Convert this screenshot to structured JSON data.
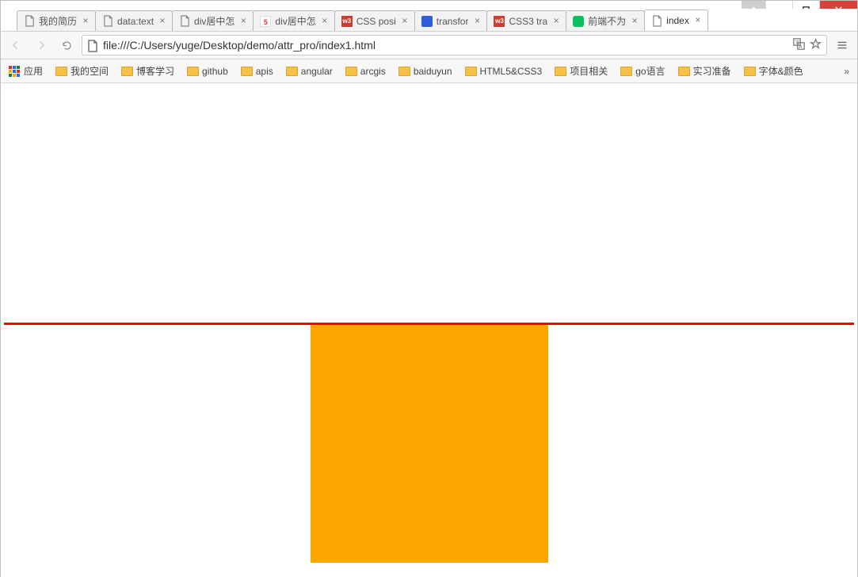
{
  "window": {
    "tabs": [
      {
        "title": "我的简历",
        "icon": "page"
      },
      {
        "title": "data:text",
        "icon": "page"
      },
      {
        "title": "div居中怎",
        "icon": "page"
      },
      {
        "title": "div居中怎",
        "icon": "s5"
      },
      {
        "title": "CSS posi",
        "icon": "w3"
      },
      {
        "title": "transfor",
        "icon": "baidu"
      },
      {
        "title": "CSS3 tra",
        "icon": "w3"
      },
      {
        "title": "前端不为",
        "icon": "wechat"
      },
      {
        "title": "index",
        "icon": "page",
        "active": true
      }
    ]
  },
  "toolbar": {
    "url": "file:///C:/Users/yuge/Desktop/demo/attr_pro/index1.html"
  },
  "bookmarks": {
    "apps_label": "应用",
    "items": [
      "我的空间",
      "博客学习",
      "github",
      "apis",
      "angular",
      "arcgis",
      "baiduyun",
      "HTML5&CSS3",
      "项目相关",
      "go语言",
      "实习准备",
      "字体&颜色"
    ],
    "overflow": "»"
  },
  "content": {
    "line_color": "#ff0000",
    "box_color": "#ffa500"
  }
}
